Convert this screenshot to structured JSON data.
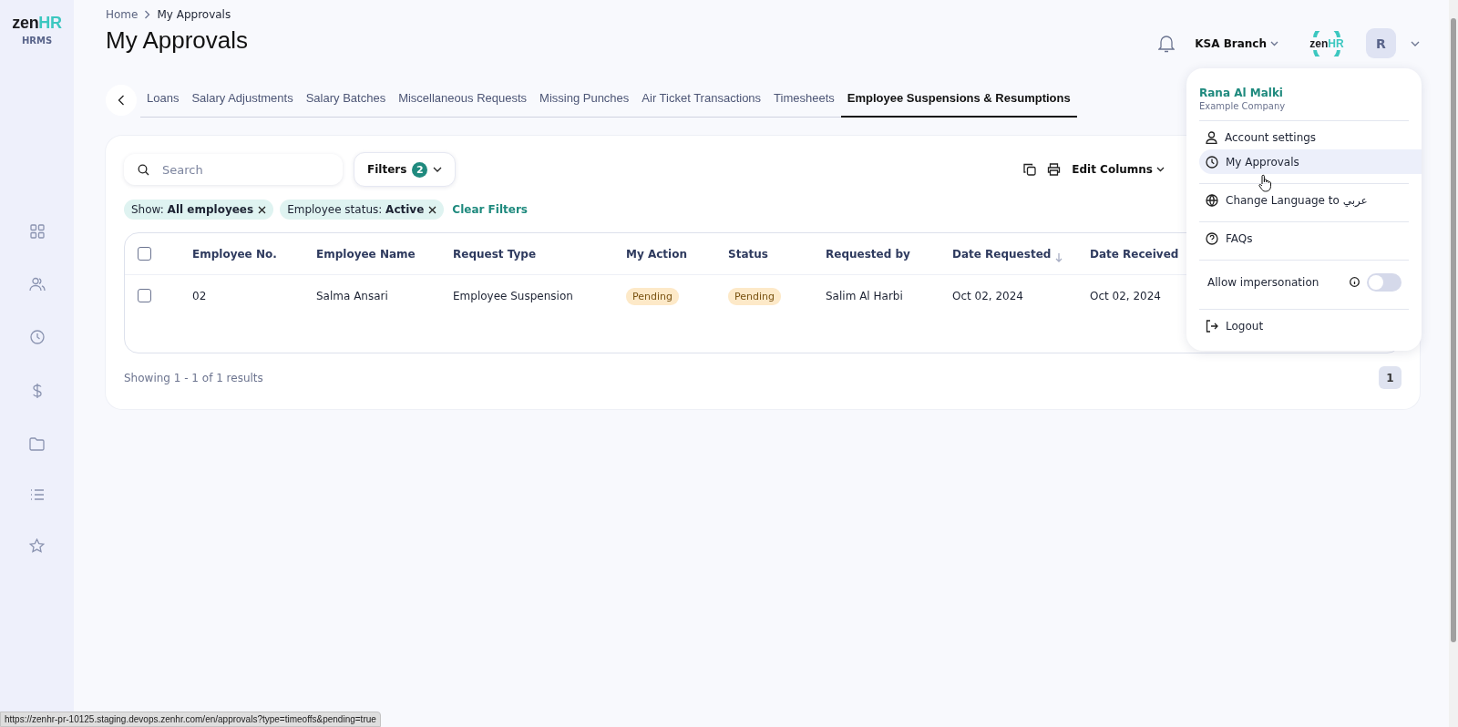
{
  "sidebar": {
    "logo": {
      "dark": "zen",
      "accent": "HR"
    },
    "product": "HRMS"
  },
  "breadcrumb": [
    "Home",
    "My Approvals"
  ],
  "title": "My Approvals",
  "header": {
    "branch": "KSA Branch",
    "brand": {
      "dark": "zen",
      "accent": "HR"
    },
    "avatar": "R"
  },
  "tabs": [
    {
      "label": "Loans",
      "selected": false
    },
    {
      "label": "Salary Adjustments",
      "selected": false
    },
    {
      "label": "Salary Batches",
      "selected": false
    },
    {
      "label": "Miscellaneous Requests",
      "selected": false
    },
    {
      "label": "Missing Punches",
      "selected": false
    },
    {
      "label": "Air Ticket Transactions",
      "selected": false
    },
    {
      "label": "Timesheets",
      "selected": false
    },
    {
      "label": "Employee Suspensions & Resumptions",
      "selected": true
    }
  ],
  "toolbar": {
    "search": {
      "placeholder": "Search"
    },
    "filters": {
      "label": "Filters",
      "count": "2"
    },
    "edit_columns": "Edit Columns"
  },
  "chips": [
    "Show: **All employees**",
    "Employee status: **Active**"
  ],
  "clear_filters": "Clear Filters",
  "table": {
    "all_checked": false,
    "columns": [
      "Employee No.",
      "Employee Name",
      "Request Type",
      "My Action",
      "Status",
      "Requested by",
      "Date Requested",
      "Date Received"
    ],
    "rows": [
      {
        "checked": false,
        "cells": [
          "02",
          "Salma Ansari",
          "Employee Suspension",
          "Pending",
          "Pending",
          "Salim Al Harbi",
          "Oct 02, 2024",
          "Oct 02, 2024"
        ]
      }
    ]
  },
  "results": "Showing 1 - 1 of 1 results",
  "pages": [
    {
      "label": "1",
      "selected": true
    }
  ],
  "menu": {
    "name": "Rana Al Malki",
    "company": "Example Company",
    "items": [
      {
        "kind": "link",
        "label": "Account settings",
        "selected": false
      },
      {
        "kind": "link",
        "label": "My Approvals",
        "selected": true
      },
      {
        "kind": "link",
        "label": "Change Language to عربي",
        "selected": false
      },
      {
        "kind": "link",
        "label": "FAQs",
        "selected": false
      },
      {
        "kind": "toggle",
        "label": "Allow impersonation",
        "on": false
      },
      {
        "kind": "link",
        "label": "Logout",
        "selected": false
      }
    ]
  },
  "status_url": "https://zenhr-pr-10125.staging.devops.zenhr.com/en/approvals?type=timeoffs&pending=true"
}
